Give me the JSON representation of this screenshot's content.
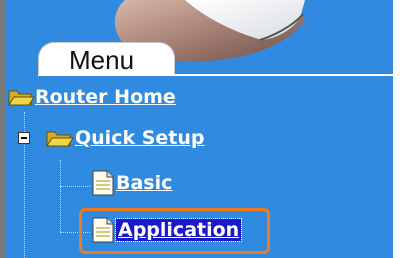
{
  "menu": {
    "title": "Menu"
  },
  "tree": {
    "root": {
      "label": "Router Home",
      "icon": "open-folder-icon"
    },
    "quick_setup": {
      "label": "Quick Setup",
      "icon": "open-folder-icon",
      "expanded": true
    },
    "basic": {
      "label": "Basic",
      "icon": "document-icon"
    },
    "application": {
      "label": "Application",
      "icon": "document-icon",
      "selected": true
    }
  },
  "colors": {
    "panel_background": "#2f8ae0",
    "selection": "#1a18c8",
    "highlight_outline": "#ee7a22",
    "folder": "#f2d64a",
    "text": "#ffffff"
  }
}
